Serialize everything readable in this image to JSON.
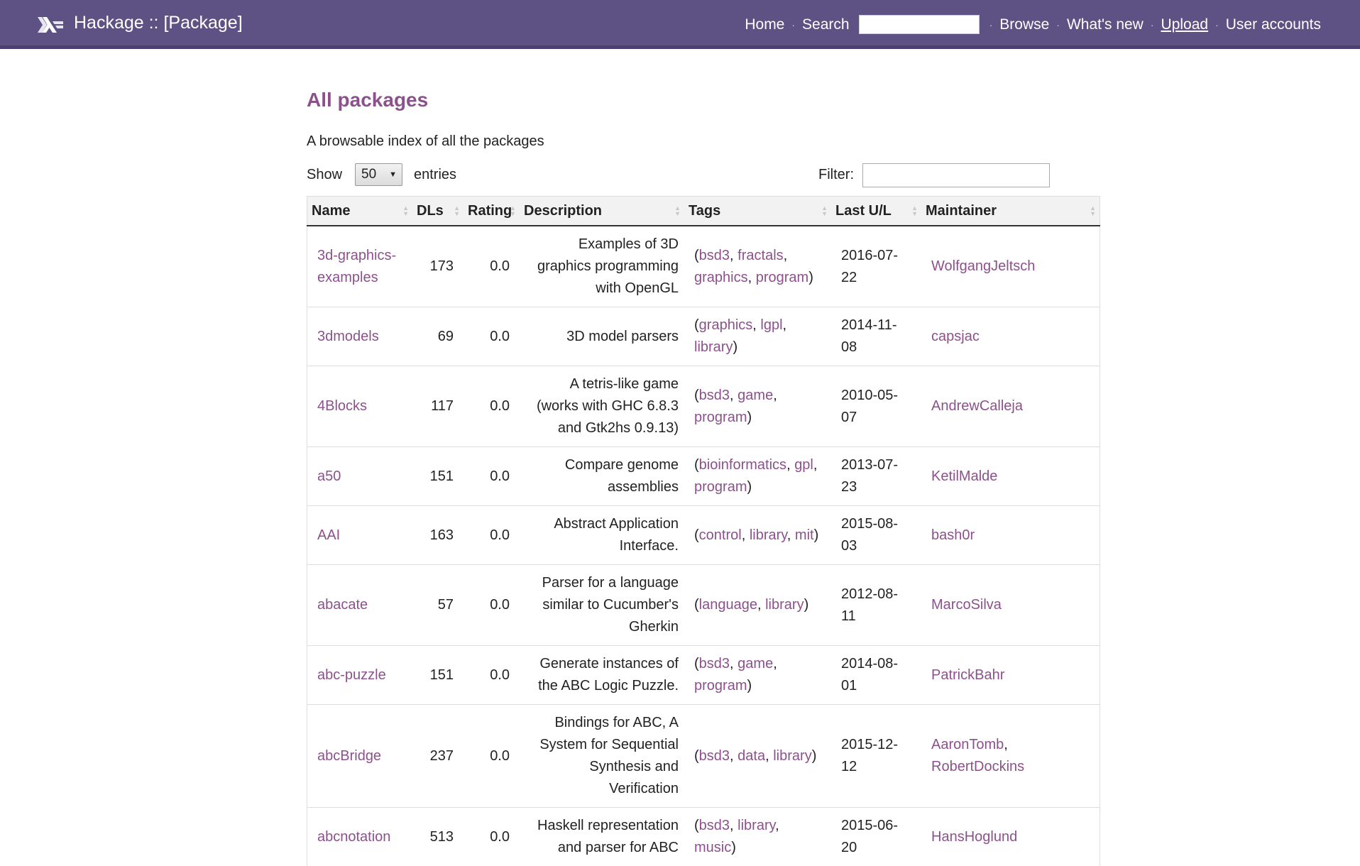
{
  "header": {
    "site_title": "Hackage :: [Package]",
    "nav": {
      "home": "Home",
      "search": "Search",
      "browse": "Browse",
      "whats_new": "What's new",
      "upload": "Upload",
      "user_accounts": "User accounts"
    },
    "logo_icon": "haskell-logo-icon"
  },
  "page": {
    "title": "All packages",
    "subtitle": "A browsable index of all the packages"
  },
  "controls": {
    "show_label": "Show",
    "entries_value": "50",
    "entries_label": "entries",
    "filter_label": "Filter:"
  },
  "table": {
    "headers": [
      "Name",
      "DLs",
      "Rating",
      "Description",
      "Tags",
      "Last U/L",
      "Maintainer"
    ],
    "rows": [
      {
        "name": "3d-graphics-examples",
        "dls": "173",
        "rating": "0.0",
        "description": "Examples of 3D graphics programming with OpenGL",
        "tags": [
          "bsd3",
          "fractals",
          "graphics",
          "program"
        ],
        "last_upload": "2016-07-22",
        "maintainers": [
          "WolfgangJeltsch"
        ]
      },
      {
        "name": "3dmodels",
        "dls": "69",
        "rating": "0.0",
        "description": "3D model parsers",
        "tags": [
          "graphics",
          "lgpl",
          "library"
        ],
        "last_upload": "2014-11-08",
        "maintainers": [
          "capsjac"
        ]
      },
      {
        "name": "4Blocks",
        "dls": "117",
        "rating": "0.0",
        "description": "A tetris-like game (works with GHC 6.8.3 and Gtk2hs 0.9.13)",
        "tags": [
          "bsd3",
          "game",
          "program"
        ],
        "last_upload": "2010-05-07",
        "maintainers": [
          "AndrewCalleja"
        ]
      },
      {
        "name": "a50",
        "dls": "151",
        "rating": "0.0",
        "description": "Compare genome assemblies",
        "tags": [
          "bioinformatics",
          "gpl",
          "program"
        ],
        "last_upload": "2013-07-23",
        "maintainers": [
          "KetilMalde"
        ]
      },
      {
        "name": "AAI",
        "dls": "163",
        "rating": "0.0",
        "description": "Abstract Application Interface.",
        "tags": [
          "control",
          "library",
          "mit"
        ],
        "last_upload": "2015-08-03",
        "maintainers": [
          "bash0r"
        ]
      },
      {
        "name": "abacate",
        "dls": "57",
        "rating": "0.0",
        "description": "Parser for a language similar to Cucumber's Gherkin",
        "tags": [
          "language",
          "library"
        ],
        "last_upload": "2012-08-11",
        "maintainers": [
          "MarcoSilva"
        ]
      },
      {
        "name": "abc-puzzle",
        "dls": "151",
        "rating": "0.0",
        "description": "Generate instances of the ABC Logic Puzzle.",
        "tags": [
          "bsd3",
          "game",
          "program"
        ],
        "last_upload": "2014-08-01",
        "maintainers": [
          "PatrickBahr"
        ]
      },
      {
        "name": "abcBridge",
        "dls": "237",
        "rating": "0.0",
        "description": "Bindings for ABC, A System for Sequential Synthesis and Verification",
        "tags": [
          "bsd3",
          "data",
          "library"
        ],
        "last_upload": "2015-12-12",
        "maintainers": [
          "AaronTomb",
          "RobertDockins"
        ]
      },
      {
        "name": "abcnotation",
        "dls": "513",
        "rating": "0.0",
        "description": "Haskell representation and parser for ABC",
        "tags": [
          "bsd3",
          "library",
          "music"
        ],
        "last_upload": "2015-06-20",
        "maintainers": [
          "HansHoglund"
        ]
      }
    ]
  },
  "colors": {
    "header_bg": "#5e5184",
    "accent_link": "#8c518c"
  }
}
